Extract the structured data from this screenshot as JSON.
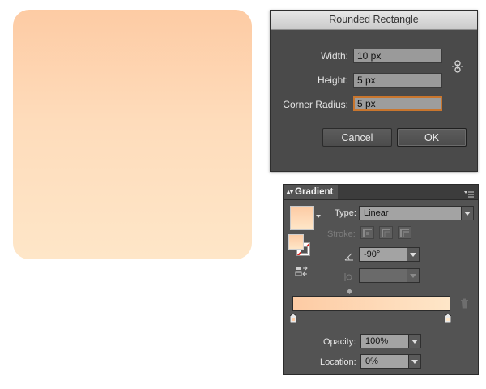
{
  "canvas": {
    "shape_gradient": {
      "from": "#fdcba4",
      "to": "#fee6c8"
    }
  },
  "dialog": {
    "title": "Rounded Rectangle",
    "fields": [
      {
        "label": "Width:",
        "value": "10 px"
      },
      {
        "label": "Height:",
        "value": "5 px"
      },
      {
        "label": "Corner Radius:",
        "value": "5 px"
      }
    ],
    "link_icon": "chain-link-icon",
    "cancel_label": "Cancel",
    "ok_label": "OK"
  },
  "gradient_panel": {
    "tab_label": "Gradient",
    "type_label": "Type:",
    "type_value": "Linear",
    "stroke_label": "Stroke:",
    "angle_value": "-90°",
    "aspect_value": "",
    "opacity_label": "Opacity:",
    "opacity_value": "100%",
    "location_label": "Location:",
    "location_value": "0%",
    "colors": {
      "start": "#fdcba4",
      "end": "#fee6c8",
      "accent_focus": "#c9762e"
    }
  }
}
